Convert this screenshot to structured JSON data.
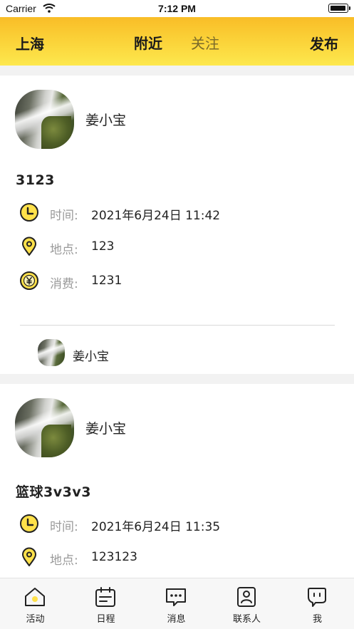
{
  "status_bar": {
    "carrier": "Carrier",
    "time": "7:12 PM"
  },
  "nav": {
    "city": "上海",
    "tab_nearby": "附近",
    "tab_follow": "关注",
    "publish": "发布"
  },
  "labels": {
    "time": "时间:",
    "place": "地点:",
    "cost": "消费:"
  },
  "colors": {
    "accent_yellow": "#fbd53b",
    "icon_yellow": "#ffe14a"
  },
  "cards": [
    {
      "author": "姜小宝",
      "title": "3123",
      "time": "2021年6月24日 11:42",
      "place": "123",
      "cost": "1231",
      "members": [
        "姜小宝"
      ]
    },
    {
      "author": "姜小宝",
      "title": "篮球3v3v3",
      "time": "2021年6月24日 11:35",
      "place": "123123"
    }
  ],
  "tabs": [
    {
      "label": "活动",
      "icon": "home-icon"
    },
    {
      "label": "日程",
      "icon": "calendar-icon"
    },
    {
      "label": "消息",
      "icon": "message-icon"
    },
    {
      "label": "联系人",
      "icon": "contacts-icon"
    },
    {
      "label": "我",
      "icon": "profile-icon"
    }
  ]
}
